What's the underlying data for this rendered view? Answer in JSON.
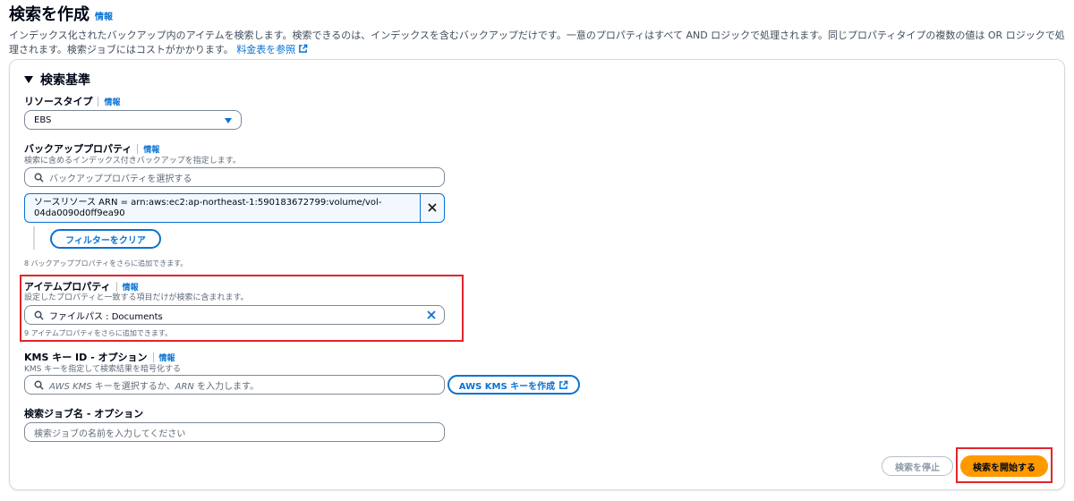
{
  "header": {
    "title": "検索を作成",
    "info": "情報",
    "description": "インデックス化されたバックアップ内のアイテムを検索します。検索できるのは、インデックスを含むバックアップだけです。一意のプロパティはすべて AND ロジックで処理されます。同じプロパティタイプの複数の値は OR ロジックで処理されます。検索ジョブにはコストがかかります。",
    "pricing_link": "料金表を参照"
  },
  "section": {
    "title": "検索基準"
  },
  "resource_type": {
    "label": "リソースタイプ",
    "info": "情報",
    "selected": "EBS"
  },
  "backup_props": {
    "label": "バックアッププロパティ",
    "info": "情報",
    "description": "検索に含めるインデックス付きバックアップを指定します。",
    "placeholder": "バックアッププロパティを選択する",
    "token_line1": "ソースリソース ARN = arn:aws:ec2:ap-northeast-1:590183672799:volume/vol-",
    "token_line2": "04da0090d0ff9ea90",
    "clear_filter": "フィルターをクリア",
    "hint": "8 バックアッププロパティをさらに追加できます。"
  },
  "item_props": {
    "label": "アイテムプロパティ",
    "info": "情報",
    "description": "設定したプロパティと一致する項目だけが検索に含まれます。",
    "value": "ファイルパス : Documents",
    "hint": "9 アイテムプロパティをさらに追加できます。"
  },
  "kms": {
    "label": "KMS キー ID - オプション",
    "info": "情報",
    "description": "KMS キーを指定して検索結果を暗号化する",
    "placeholder_a": "AWS KMS",
    "placeholder_b": " キーを選択するか、",
    "placeholder_c": "ARN",
    "placeholder_d": " を入力します。",
    "create_button": "AWS KMS キーを作成"
  },
  "job_name": {
    "label": "検索ジョブ名 - オプション",
    "placeholder": "検索ジョブの名前を入力してください"
  },
  "footer": {
    "stop_button": "検索を停止",
    "start_button": "検索を開始する"
  },
  "colors": {
    "accent": "#0972d3",
    "primary": "#ff9900",
    "highlight": "#e3242b"
  }
}
